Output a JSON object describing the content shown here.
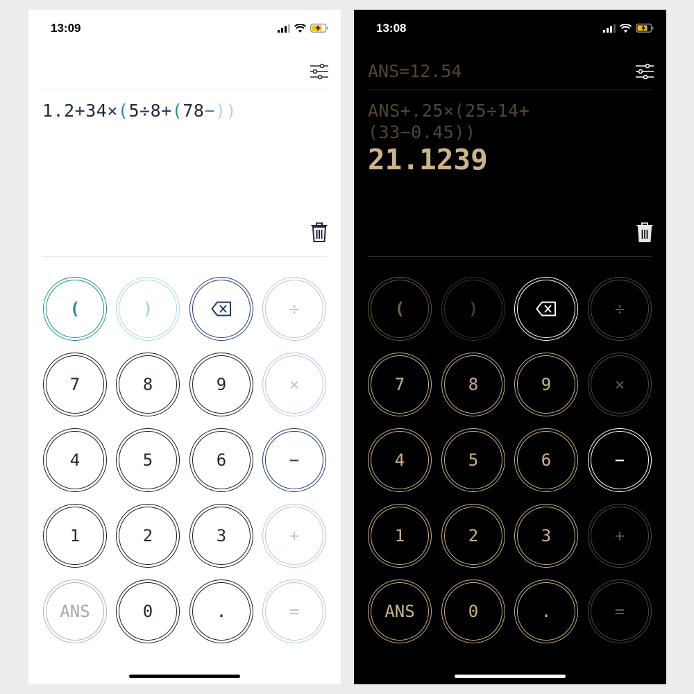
{
  "light": {
    "status": {
      "time": "13:09"
    },
    "expression": {
      "tokens": [
        {
          "text": "1.2",
          "role": "c-num"
        },
        {
          "text": "+",
          "role": "c-op"
        },
        {
          "text": "34",
          "role": "c-num"
        },
        {
          "text": "×",
          "role": "c-op"
        },
        {
          "text": "(",
          "role": "c-p1"
        },
        {
          "text": "5",
          "role": "c-num"
        },
        {
          "text": "÷",
          "role": "c-op"
        },
        {
          "text": "8",
          "role": "c-num"
        },
        {
          "text": "+",
          "role": "c-op"
        },
        {
          "text": "(",
          "role": "c-p1"
        },
        {
          "text": "78",
          "role": "c-num"
        },
        {
          "text": "−",
          "role": "c-minus"
        },
        {
          "text": ")",
          "role": "c-p2"
        },
        {
          "text": ")",
          "role": "c-p2"
        }
      ]
    },
    "keys": {
      "open_paren": "(",
      "close_paren": ")",
      "divide": "÷",
      "seven": "7",
      "eight": "8",
      "nine": "9",
      "multiply": "×",
      "four": "4",
      "five": "5",
      "six": "6",
      "minus": "−",
      "one": "1",
      "two": "2",
      "three": "3",
      "plus": "+",
      "ans": "ANS",
      "zero": "0",
      "dot": ".",
      "equals": "="
    }
  },
  "dark": {
    "status": {
      "time": "13:08"
    },
    "ans_line": "ANS=12.54",
    "expression": "ANS+.25×(25÷14+(33−0.45))",
    "result": "21.1239",
    "keys": {
      "open_paren": "(",
      "close_paren": ")",
      "divide": "÷",
      "seven": "7",
      "eight": "8",
      "nine": "9",
      "multiply": "×",
      "four": "4",
      "five": "5",
      "six": "6",
      "minus": "−",
      "one": "1",
      "two": "2",
      "three": "3",
      "plus": "+",
      "ans": "ANS",
      "zero": "0",
      "dot": ".",
      "equals": "="
    }
  },
  "colors": {
    "accent_teal": "#1f8f8f",
    "accent_navy": "#1f3b6b",
    "dark_gold": "#ccb38a",
    "dark_brown": "#54462f"
  },
  "icons": {
    "settings": "sliders-icon",
    "clear": "trash-icon",
    "backspace": "backspace-icon",
    "signal": "signal-icon",
    "wifi": "wifi-icon",
    "battery": "battery-charging-icon"
  }
}
